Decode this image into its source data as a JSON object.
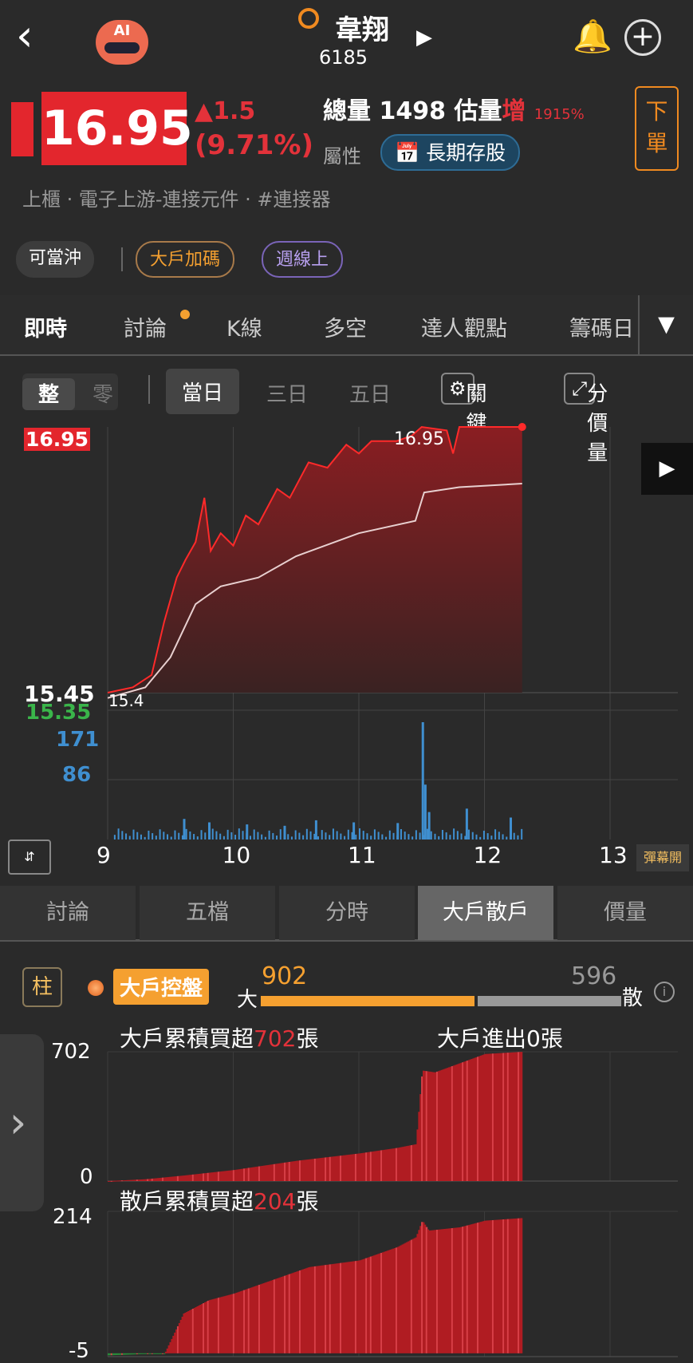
{
  "header": {
    "stock_name": "韋翔",
    "stock_code": "6185",
    "ai_label": "AI"
  },
  "quote": {
    "price": "16.95",
    "change": "▲1.5",
    "change_pct": "(9.71%)",
    "volume_label": "總量",
    "volume": "1498",
    "est_label": "估量",
    "est_dir": "增",
    "est_pct": "1915%",
    "attr_label": "屬性",
    "attr_tag": "長期存股",
    "order_button": "下單"
  },
  "industry": "上櫃 · 電子上游-連接元件 · #連接器",
  "tags": [
    "可當沖",
    "大戶加碼",
    "週線上"
  ],
  "tabs": [
    "即時",
    "討論",
    "K線",
    "多空",
    "達人觀點",
    "籌碼日"
  ],
  "sub": {
    "modes": [
      "整",
      "零"
    ],
    "ranges": [
      "當日",
      "三日",
      "五日"
    ],
    "key_price": "關鍵價",
    "price_volume": "分價量"
  },
  "colors": {
    "up": "#e3323a",
    "down": "#3ab54a",
    "accent": "#f5a030",
    "vol": "#3f8fd0"
  },
  "chart_data": [
    {
      "type": "line",
      "title": "intraday",
      "y_labels": {
        "high": "16.95",
        "open": "15.45",
        "low": "15.35",
        "vol_max": "171",
        "vol_mid": "86"
      },
      "annotations": {
        "peak": "16.95",
        "start": "15.4"
      },
      "x_ticks": [
        "9",
        "10",
        "11",
        "12",
        "13"
      ],
      "xlim": [
        9,
        13
      ],
      "ylim": [
        15.45,
        16.95
      ],
      "price": [
        [
          9,
          15.45
        ],
        [
          9.2,
          15.48
        ],
        [
          9.35,
          15.55
        ],
        [
          9.45,
          15.85
        ],
        [
          9.55,
          16.1
        ],
        [
          9.62,
          16.2
        ],
        [
          9.7,
          16.3
        ],
        [
          9.77,
          16.55
        ],
        [
          9.82,
          16.25
        ],
        [
          9.9,
          16.35
        ],
        [
          10,
          16.28
        ],
        [
          10.1,
          16.45
        ],
        [
          10.2,
          16.4
        ],
        [
          10.35,
          16.6
        ],
        [
          10.45,
          16.55
        ],
        [
          10.6,
          16.75
        ],
        [
          10.75,
          16.72
        ],
        [
          10.9,
          16.85
        ],
        [
          11,
          16.8
        ],
        [
          11.1,
          16.87
        ],
        [
          11.3,
          16.87
        ],
        [
          11.42,
          16.9
        ],
        [
          11.5,
          16.95
        ],
        [
          11.7,
          16.93
        ],
        [
          11.75,
          16.8
        ],
        [
          11.8,
          16.95
        ],
        [
          12.3,
          16.95
        ]
      ],
      "avg": [
        [
          9,
          15.42
        ],
        [
          9.3,
          15.48
        ],
        [
          9.5,
          15.65
        ],
        [
          9.7,
          15.95
        ],
        [
          9.9,
          16.05
        ],
        [
          10.2,
          16.1
        ],
        [
          10.5,
          16.22
        ],
        [
          11,
          16.35
        ],
        [
          11.45,
          16.42
        ],
        [
          11.52,
          16.58
        ],
        [
          11.8,
          16.61
        ],
        [
          12.3,
          16.63
        ]
      ],
      "volume": [
        [
          9.6,
          30
        ],
        [
          9.8,
          25
        ],
        [
          10.1,
          22
        ],
        [
          10.4,
          20
        ],
        [
          10.65,
          28
        ],
        [
          10.95,
          25
        ],
        [
          11.3,
          24
        ],
        [
          11.5,
          171
        ],
        [
          11.52,
          80
        ],
        [
          11.55,
          40
        ],
        [
          11.85,
          45
        ],
        [
          12.2,
          32
        ]
      ],
      "vol_max": 171
    },
    {
      "type": "area",
      "title": "大戶累積買超",
      "value": "702",
      "unit": "張",
      "side": "大戶進出0張",
      "y_labels": [
        "702",
        "0"
      ],
      "ylim": [
        0,
        702
      ],
      "series": [
        [
          9,
          0
        ],
        [
          9.3,
          10
        ],
        [
          9.6,
          30
        ],
        [
          10,
          60
        ],
        [
          10.5,
          110
        ],
        [
          11,
          150
        ],
        [
          11.3,
          180
        ],
        [
          11.45,
          200
        ],
        [
          11.5,
          600
        ],
        [
          11.6,
          590
        ],
        [
          11.8,
          640
        ],
        [
          12,
          690
        ],
        [
          12.3,
          702
        ]
      ]
    },
    {
      "type": "area",
      "title": "散戶累積買超",
      "value": "204",
      "unit": "張",
      "y_labels": [
        "214",
        "-5"
      ],
      "ylim": [
        -5,
        214
      ],
      "series": [
        [
          9,
          -3
        ],
        [
          9.45,
          0
        ],
        [
          9.6,
          60
        ],
        [
          9.8,
          80
        ],
        [
          10,
          90
        ],
        [
          10.3,
          110
        ],
        [
          10.6,
          130
        ],
        [
          11,
          140
        ],
        [
          11.3,
          160
        ],
        [
          11.45,
          175
        ],
        [
          11.5,
          200
        ],
        [
          11.55,
          185
        ],
        [
          11.8,
          190
        ],
        [
          12,
          200
        ],
        [
          12.3,
          204
        ]
      ]
    }
  ],
  "bottom_tabs": [
    "討論",
    "五檔",
    "分時",
    "大戶散戶",
    "價量"
  ],
  "control": {
    "chart_type": "柱",
    "badge": "大戶控盤",
    "big_label": "大",
    "big": "902",
    "small": "596",
    "small_label": "散",
    "big_ratio": 0.602
  },
  "danmaku": "彈幕開"
}
